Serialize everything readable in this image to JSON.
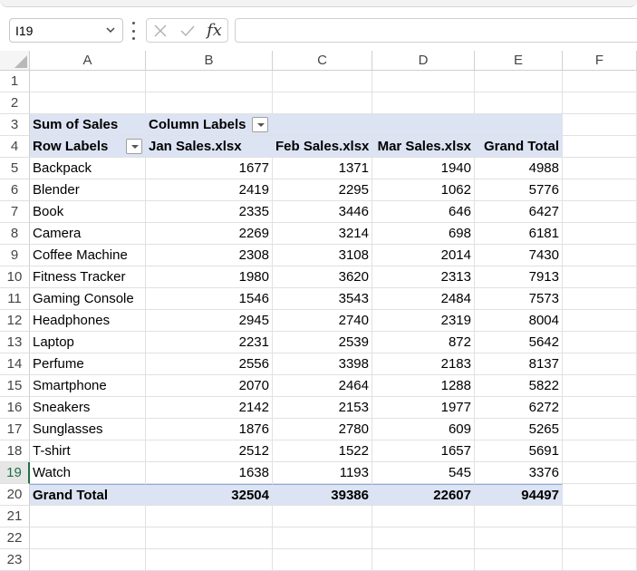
{
  "formula_bar": {
    "name_box": "I19",
    "fx_label": "fx",
    "formula_value": ""
  },
  "columns": [
    "A",
    "B",
    "C",
    "D",
    "E",
    "F"
  ],
  "rows": [
    "1",
    "2",
    "3",
    "4",
    "5",
    "6",
    "7",
    "8",
    "9",
    "10",
    "11",
    "12",
    "13",
    "14",
    "15",
    "16",
    "17",
    "18",
    "19",
    "20",
    "21",
    "22",
    "23"
  ],
  "active_row": "19",
  "pivot": {
    "sum_label": "Sum of Sales",
    "column_labels": "Column Labels",
    "row_labels": "Row Labels",
    "headers": [
      "Jan Sales.xlsx",
      "Feb Sales.xlsx",
      "Mar Sales.xlsx",
      "Grand Total"
    ],
    "items": [
      {
        "name": "Backpack",
        "values": [
          "1677",
          "1371",
          "1940",
          "4988"
        ]
      },
      {
        "name": "Blender",
        "values": [
          "2419",
          "2295",
          "1062",
          "5776"
        ]
      },
      {
        "name": "Book",
        "values": [
          "2335",
          "3446",
          "646",
          "6427"
        ]
      },
      {
        "name": "Camera",
        "values": [
          "2269",
          "3214",
          "698",
          "6181"
        ]
      },
      {
        "name": "Coffee Machine",
        "values": [
          "2308",
          "3108",
          "2014",
          "7430"
        ]
      },
      {
        "name": "Fitness Tracker",
        "values": [
          "1980",
          "3620",
          "2313",
          "7913"
        ]
      },
      {
        "name": "Gaming Console",
        "values": [
          "1546",
          "3543",
          "2484",
          "7573"
        ]
      },
      {
        "name": "Headphones",
        "values": [
          "2945",
          "2740",
          "2319",
          "8004"
        ]
      },
      {
        "name": "Laptop",
        "values": [
          "2231",
          "2539",
          "872",
          "5642"
        ]
      },
      {
        "name": "Perfume",
        "values": [
          "2556",
          "3398",
          "2183",
          "8137"
        ]
      },
      {
        "name": "Smartphone",
        "values": [
          "2070",
          "2464",
          "1288",
          "5822"
        ]
      },
      {
        "name": "Sneakers",
        "values": [
          "2142",
          "2153",
          "1977",
          "6272"
        ]
      },
      {
        "name": "Sunglasses",
        "values": [
          "1876",
          "2780",
          "609",
          "5265"
        ]
      },
      {
        "name": "T-shirt",
        "values": [
          "2512",
          "1522",
          "1657",
          "5691"
        ]
      },
      {
        "name": "Watch",
        "values": [
          "1638",
          "1193",
          "545",
          "3376"
        ]
      }
    ],
    "grand_total": {
      "label": "Grand Total",
      "values": [
        "32504",
        "39386",
        "22607",
        "94497"
      ]
    }
  }
}
